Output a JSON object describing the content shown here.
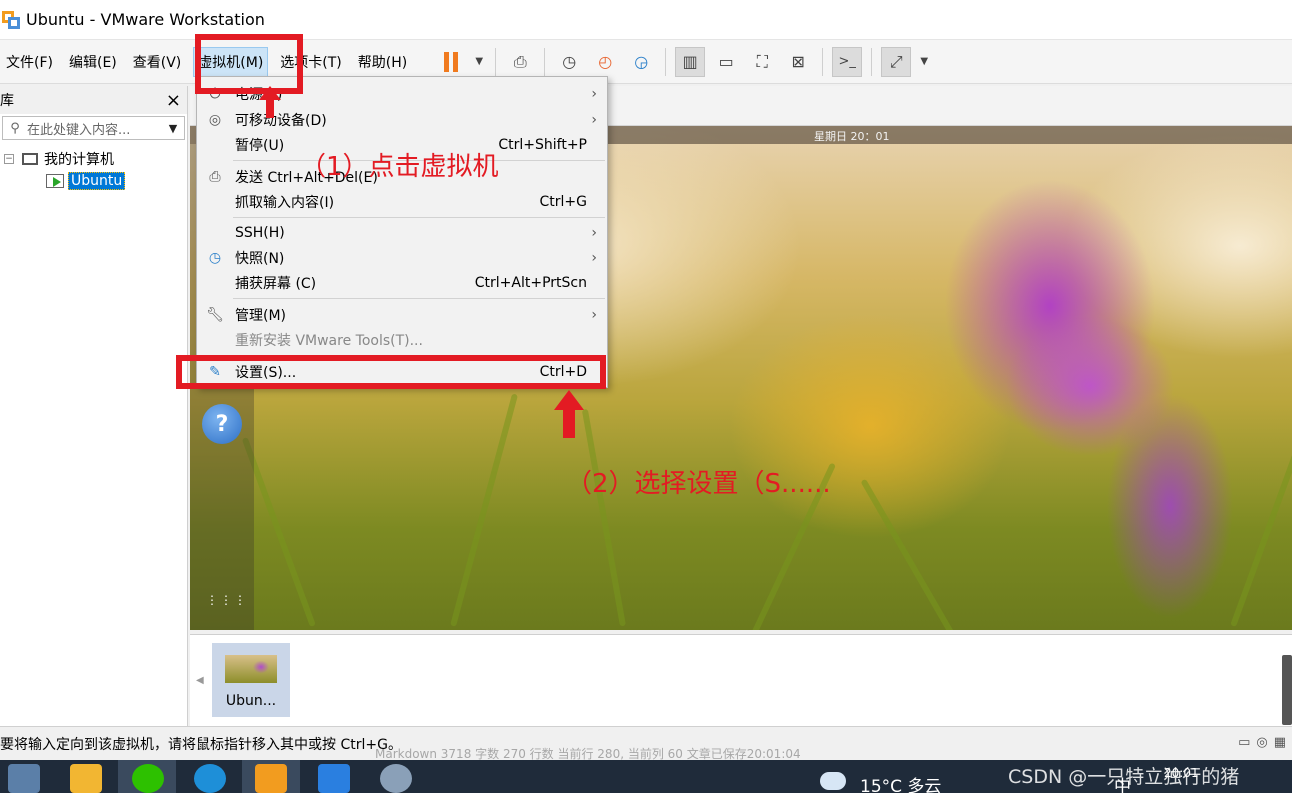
{
  "window": {
    "title": "Ubuntu - VMware Workstation"
  },
  "menubar": {
    "items": [
      "文件(F)",
      "编辑(E)",
      "查看(V)",
      "虚拟机(M)",
      "选项卡(T)",
      "帮助(H)"
    ],
    "active_index": 3
  },
  "toolbar": {
    "icons": [
      "pause-icon",
      "send-keys-icon",
      "snapshot-take-icon",
      "snapshot-revert-icon",
      "snapshot-manager-icon",
      "sidebar-view-icon",
      "thumbnail-view-icon",
      "fit-view-icon",
      "autofit-icon",
      "console-icon",
      "fullscreen-icon"
    ]
  },
  "library": {
    "title": "库",
    "close": "×",
    "search_placeholder": "在此处键入内容...",
    "tree_root": "我的计算机",
    "tree_vm": "Ubuntu"
  },
  "vm": {
    "clock": "星期日 20：01",
    "help": "?",
    "apps": "⋮⋮⋮"
  },
  "vm_menu": {
    "items": [
      {
        "label": "电源(P)",
        "shortcut": "",
        "submenu": true,
        "icon": "power-icon"
      },
      {
        "label": "可移动设备(D)",
        "shortcut": "",
        "submenu": true,
        "icon": "removable-device-icon"
      },
      {
        "label": "暂停(U)",
        "shortcut": "Ctrl+Shift+P",
        "submenu": false,
        "icon": ""
      },
      {
        "label": "发送 Ctrl+Alt+Del(E)",
        "shortcut": "",
        "submenu": false,
        "icon": "send-keys-icon"
      },
      {
        "label": "抓取输入内容(I)",
        "shortcut": "Ctrl+G",
        "submenu": false,
        "icon": ""
      },
      {
        "label": "SSH(H)",
        "shortcut": "",
        "submenu": true,
        "icon": ""
      },
      {
        "label": "快照(N)",
        "shortcut": "",
        "submenu": true,
        "icon": "snapshot-icon"
      },
      {
        "label": "捕获屏幕 (C)",
        "shortcut": "Ctrl+Alt+PrtScn",
        "submenu": false,
        "icon": ""
      },
      {
        "label": "管理(M)",
        "shortcut": "",
        "submenu": true,
        "icon": "wrench-icon"
      },
      {
        "label": "重新安装 VMware Tools(T)...",
        "shortcut": "",
        "submenu": false,
        "icon": "",
        "disabled": true
      },
      {
        "label": "设置(S)...",
        "shortcut": "Ctrl+D",
        "submenu": false,
        "icon": "settings-icon"
      }
    ]
  },
  "annotations": {
    "step1": "（1）点击虚拟机",
    "step2": "（2）选择设置（S......",
    "color": "#e31b23"
  },
  "thumbnail": {
    "label": "Ubun..."
  },
  "statusbar": {
    "text": "要将输入定向到该虚拟机，请将鼠标指针移入其中或按 Ctrl+G。",
    "behind": "Markdown  3718 字数  270 行数  当前行 280, 当前列 60  文章已保存20:01:04"
  },
  "taskbar": {
    "weather": "15°C  多云",
    "ime": "中",
    "time": "20:01",
    "watermark": "CSDN @一只特立独行的猪 ️"
  }
}
